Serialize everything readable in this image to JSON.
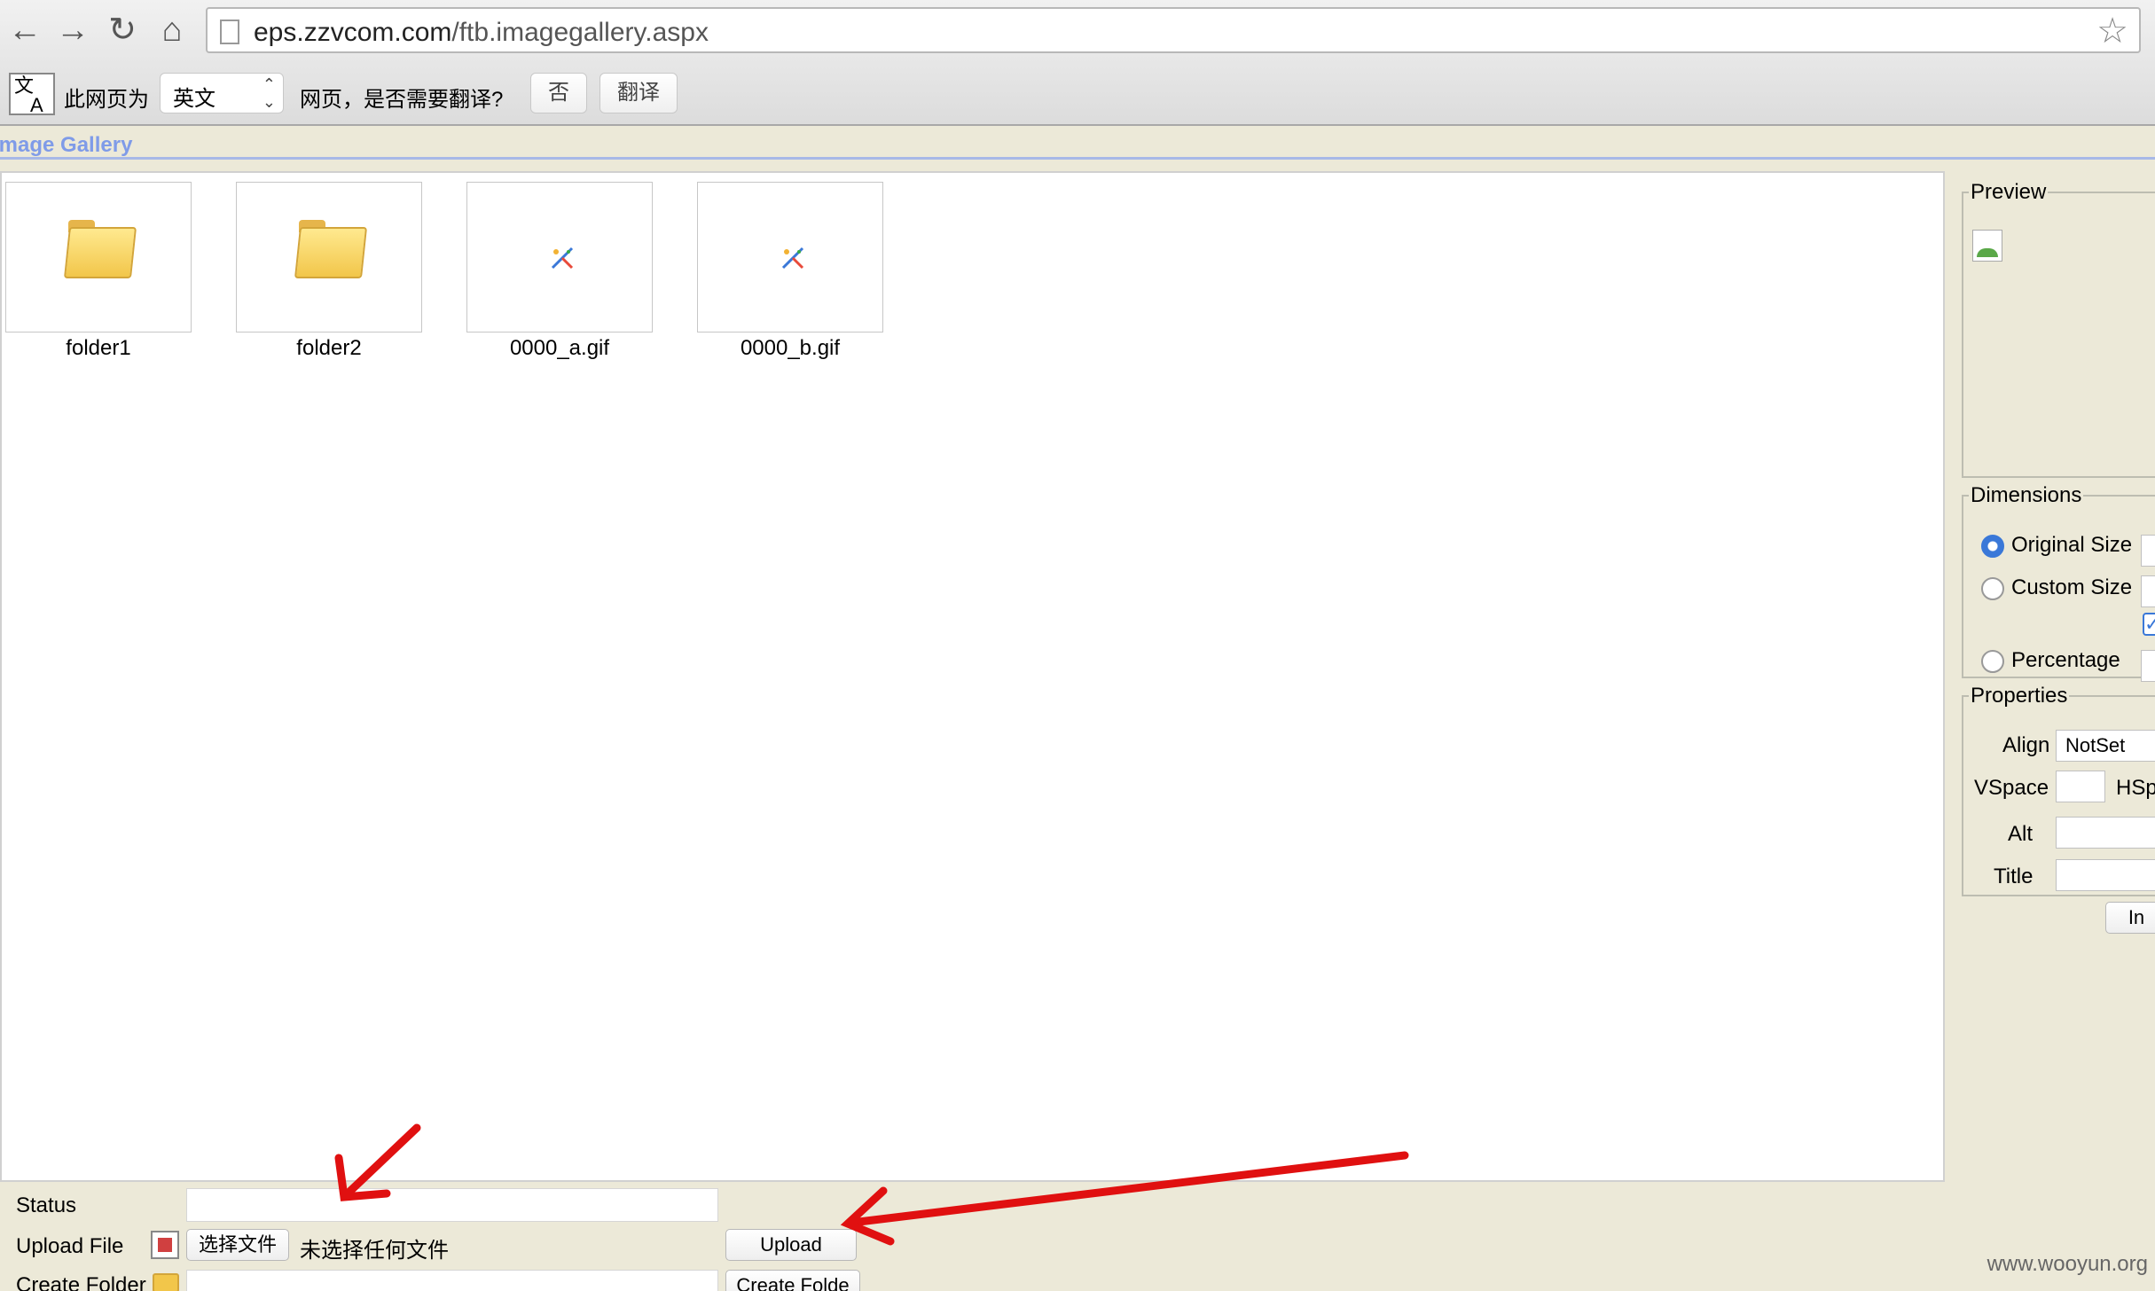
{
  "browser": {
    "url_host": "eps.zzvcom.com",
    "url_path": "/ftb.imagegallery.aspx",
    "back_icon": "arrow-left",
    "forward_icon": "arrow-right",
    "reload_icon": "reload",
    "home_icon": "home",
    "bookmark_icon": "star-outline"
  },
  "translate_bar": {
    "icon_text_top": "文",
    "icon_text_bottom": "A",
    "prefix": "此网页为",
    "language": "英文",
    "question": "网页，是否需要翻译?",
    "no_button": "否",
    "translate_button": "翻译"
  },
  "gallery": {
    "title": "Image Gallery",
    "items": [
      {
        "label": "folder1",
        "type": "folder"
      },
      {
        "label": "folder2",
        "type": "folder"
      },
      {
        "label": "0000_a.gif",
        "type": "image"
      },
      {
        "label": "0000_b.gif",
        "type": "image"
      }
    ]
  },
  "preview": {
    "legend": "Preview"
  },
  "dimensions": {
    "legend": "Dimensions",
    "original_size": "Original Size",
    "custom_size": "Custom Size",
    "percentage": "Percentage",
    "selected": "Original Size",
    "constrain_checked": true
  },
  "properties": {
    "legend": "Properties",
    "align_label": "Align",
    "align_value": "NotSet",
    "vspace_label": "VSpace",
    "hspace_label": "HSpa",
    "alt_label": "Alt",
    "title_label": "Title",
    "insert_button": "In"
  },
  "bottom": {
    "status_label": "Status",
    "upload_label": "Upload File",
    "choose_file_button": "选择文件",
    "no_file_text": "未选择任何文件",
    "upload_button": "Upload",
    "create_folder_label": "Create Folder",
    "create_folder_button": "Create Folde"
  },
  "watermark": "www.wooyun.org",
  "colors": {
    "background": "#ece9d8",
    "title_blue": "#7f9be8",
    "arrow_red": "#e01010",
    "radio_blue": "#3a78d8"
  }
}
